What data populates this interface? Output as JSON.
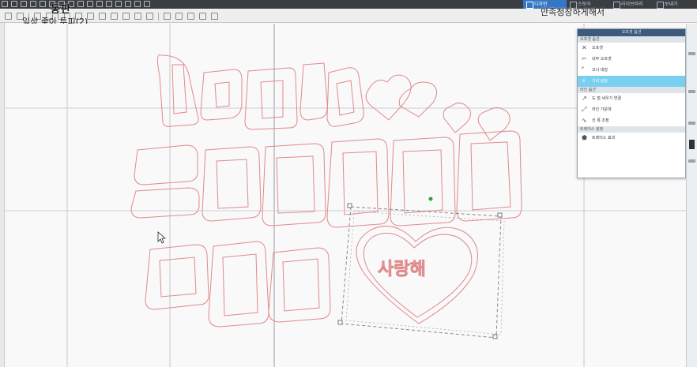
{
  "document": {
    "title": "동판",
    "subtitle": "일상 좋아 투피(2)"
  },
  "tabs": [
    {
      "label": "디자인",
      "active": true
    },
    {
      "label": "스토어",
      "active": false
    },
    {
      "label": "라이브러리",
      "active": false
    },
    {
      "label": "보내기",
      "active": false
    }
  ],
  "overlay_caption": "만족청장하게해서",
  "panel": {
    "title": "오프셋 옵션",
    "sections": [
      {
        "label": "오프셋 옵션",
        "items": [
          {
            "label": "오프셋",
            "icon": "offset-icon",
            "selected": false
          },
          {
            "label": "내부 오프셋",
            "icon": "inner-offset-icon",
            "selected": false
          },
          {
            "label": "코너 대칭",
            "icon": "corner-icon",
            "selected": false
          },
          {
            "label": "거리 설정",
            "icon": "distance-icon",
            "selected": true
          }
        ]
      },
      {
        "label": "라인 옵션",
        "items": [
          {
            "label": "도 점 세우기 연결",
            "icon": "connect-icon",
            "selected": false
          },
          {
            "label": "라인 가운데",
            "icon": "line-center-icon",
            "selected": false
          },
          {
            "label": "선 폭 조정",
            "icon": "line-width-icon",
            "selected": false
          }
        ]
      },
      {
        "label": "트레이스 설정",
        "items": [
          {
            "label": "트레이스 효과",
            "icon": "trace-icon",
            "selected": false
          }
        ]
      }
    ]
  },
  "canvas": {
    "heart_text": "사랑해"
  },
  "colors": {
    "toolbar_bg": "#3a3d42",
    "active_tab": "#3577c4",
    "selected_item": "#78cff0",
    "cut_line": "#e06060",
    "selection_node": "#2ea043"
  }
}
